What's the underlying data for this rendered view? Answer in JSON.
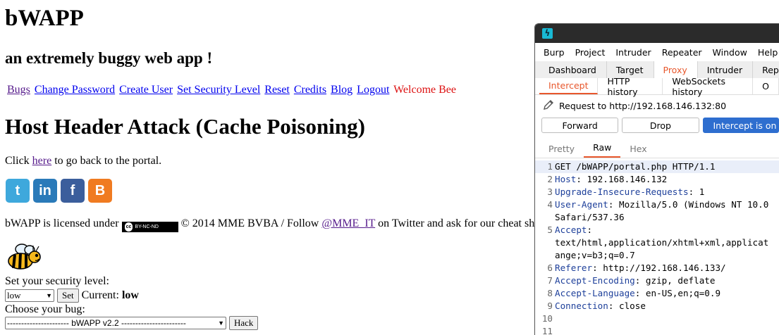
{
  "bwapp": {
    "logo": "bWAPP",
    "tagline": "an extremely buggy web app !",
    "menu": [
      {
        "label": "Bugs",
        "visited": true
      },
      {
        "label": "Change Password",
        "visited": false
      },
      {
        "label": "Create User",
        "visited": false
      },
      {
        "label": "Set Security Level",
        "visited": false
      },
      {
        "label": "Reset",
        "visited": false
      },
      {
        "label": "Credits",
        "visited": false
      },
      {
        "label": "Blog",
        "visited": false
      },
      {
        "label": "Logout",
        "visited": false
      }
    ],
    "welcome": "Welcome Bee",
    "title": "Host Header Attack (Cache Poisoning)",
    "back_prefix": "Click ",
    "back_link": "here",
    "back_suffix": " to go back to the portal.",
    "social": [
      {
        "icon": "twitter-icon",
        "glyph": "t",
        "color": "#3ea8dc"
      },
      {
        "icon": "linkedin-icon",
        "glyph": "in",
        "color": "#2a7ab9"
      },
      {
        "icon": "facebook-icon",
        "glyph": "f",
        "color": "#3b5e9c"
      },
      {
        "icon": "blogger-icon",
        "glyph": "B",
        "color": "#f07b21"
      }
    ],
    "license_prefix": "bWAPP is licensed under ",
    "cc_badge": "BY-NC-ND",
    "license_mid": " © 2014 MME BVBA / Follow ",
    "license_link": "@MME_IT",
    "license_suffix": " on Twitter and ask for our cheat sh",
    "security_label": "Set your security level:",
    "security_select": "low",
    "set_button": "Set",
    "current_label": "Current: ",
    "current_value": "low",
    "bug_label": "Choose your bug:",
    "bug_select": "---------------------- bWAPP v2.2 -----------------------",
    "hack_button": "Hack"
  },
  "burp": {
    "logo_glyph": "ϟ",
    "menu": [
      "Burp",
      "Project",
      "Intruder",
      "Repeater",
      "Window",
      "Help"
    ],
    "tool_tabs": [
      "Dashboard",
      "Target",
      "Proxy",
      "Intruder",
      "Rep"
    ],
    "active_tool_tab": "Proxy",
    "proxy_tabs": [
      "Intercept",
      "HTTP history",
      "WebSockets history",
      "O"
    ],
    "active_proxy_tab": "Intercept",
    "request_to": "Request to http://192.168.146.132:80",
    "buttons": {
      "forward": "Forward",
      "drop": "Drop",
      "intercept": "Intercept is on"
    },
    "view_tabs": [
      "Pretty",
      "Raw",
      "Hex"
    ],
    "active_view_tab": "Raw",
    "request_lines": [
      {
        "num": "1",
        "key": "",
        "rest": "GET /bWAPP/portal.php HTTP/1.1"
      },
      {
        "num": "2",
        "key": "Host",
        "rest": ": 192.168.146.132"
      },
      {
        "num": "3",
        "key": "Upgrade-Insecure-Requests",
        "rest": ": 1"
      },
      {
        "num": "4",
        "key": "User-Agent",
        "rest": ": Mozilla/5.0 (Windows NT 10.0"
      },
      {
        "num": "",
        "key": "",
        "rest": "Safari/537.36"
      },
      {
        "num": "5",
        "key": "Accept",
        "rest": ":"
      },
      {
        "num": "",
        "key": "",
        "rest": "text/html,application/xhtml+xml,applicat"
      },
      {
        "num": "",
        "key": "",
        "rest": "ange;v=b3;q=0.7"
      },
      {
        "num": "6",
        "key": "Referer",
        "rest": ": http://192.168.146.133/"
      },
      {
        "num": "7",
        "key": "Accept-Encoding",
        "rest": ": gzip, deflate"
      },
      {
        "num": "8",
        "key": "Accept-Language",
        "rest": ": en-US,en;q=0.9"
      },
      {
        "num": "9",
        "key": "Connection",
        "rest": ": close"
      },
      {
        "num": "10",
        "key": "",
        "rest": ""
      },
      {
        "num": "11",
        "key": "",
        "rest": ""
      }
    ]
  }
}
